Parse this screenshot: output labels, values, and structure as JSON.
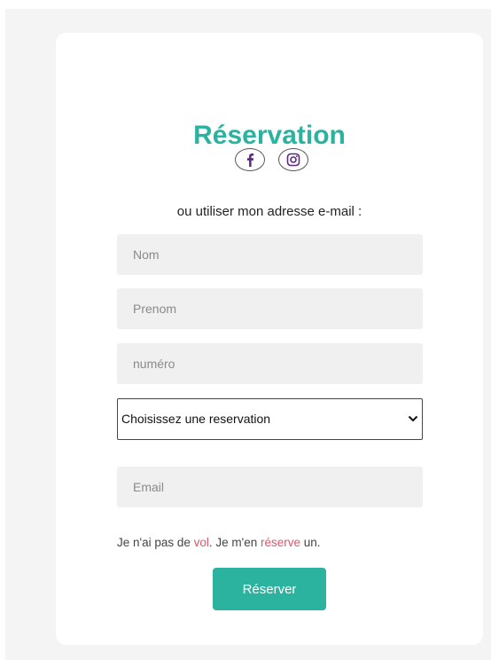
{
  "form": {
    "title": "Réservation",
    "subtitle": "ou utiliser mon adresse e-mail :",
    "fields": {
      "nom_placeholder": "Nom",
      "prenom_placeholder": "Prenom",
      "numero_placeholder": "numéro",
      "email_placeholder": "Email"
    },
    "select": {
      "selected": "Choisissez une reservation"
    },
    "note": {
      "part1": "Je n'ai pas de ",
      "link1": "vol",
      "part2": ". Je m'en ",
      "link2": "réserve",
      "part3": " un."
    },
    "submit_label": "Réserver"
  },
  "socials": {
    "facebook_icon": "facebook-icon",
    "instagram_icon": "instagram-icon",
    "icon_color": "#5a2a82"
  },
  "colors": {
    "accent": "#2bb3a0",
    "link": "#e0556b",
    "field_bg": "#f0f0f0"
  }
}
